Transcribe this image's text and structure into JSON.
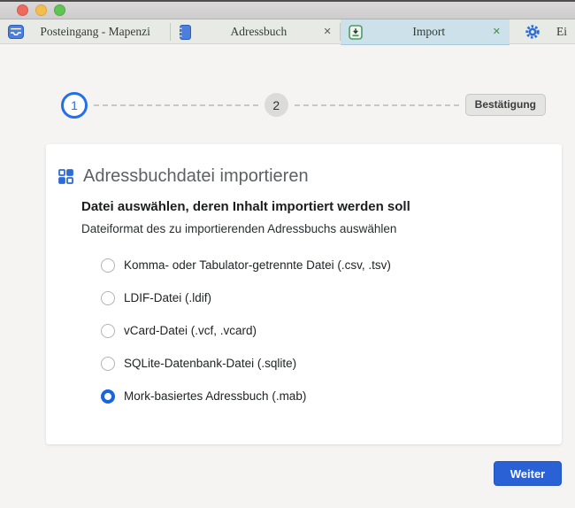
{
  "window": {
    "controls": [
      "close",
      "minimize",
      "zoom"
    ]
  },
  "tabs": [
    {
      "label": "Posteingang - Mapenzi",
      "icon": "inbox-icon",
      "active": false
    },
    {
      "label": "Adressbuch",
      "icon": "address-book-icon",
      "active": false,
      "close_glyph": "✕"
    },
    {
      "label": "Import",
      "icon": "import-icon",
      "active": true,
      "close_glyph": "✕"
    },
    {
      "label": "Ei",
      "icon": "gear-icon",
      "active": false
    }
  ],
  "stepper": {
    "step1": "1",
    "step2": "2",
    "confirm_label": "Bestätigung"
  },
  "main": {
    "title": "Adressbuchdatei importieren",
    "subtitle": "Datei auswählen, deren Inhalt importiert werden soll",
    "description": "Dateiformat des zu importierenden Adressbuchs auswählen",
    "options": [
      {
        "label": "Komma- oder Tabulator-getrennte Datei (.csv, .tsv)",
        "selected": false
      },
      {
        "label": "LDIF-Datei (.ldif)",
        "selected": false
      },
      {
        "label": "vCard-Datei (.vcf, .vcard)",
        "selected": false
      },
      {
        "label": "SQLite-Datenbank-Datei (.sqlite)",
        "selected": false
      },
      {
        "label": "Mork-basiertes Adressbuch (.mab)",
        "selected": true
      }
    ],
    "next_button": "Weiter"
  },
  "colors": {
    "accent_blue": "#2a62d6",
    "step_active_blue": "#2470e8",
    "radio_selected_blue": "#1766e0",
    "active_tab_bg": "#cde1eb",
    "tabbar_bg": "#e8ebe5",
    "tab_icon_blue": "#4b7fd9",
    "import_icon_green": "#4e9b66",
    "card_bg": "#ffffff",
    "page_bg": "#f5f4f2"
  }
}
